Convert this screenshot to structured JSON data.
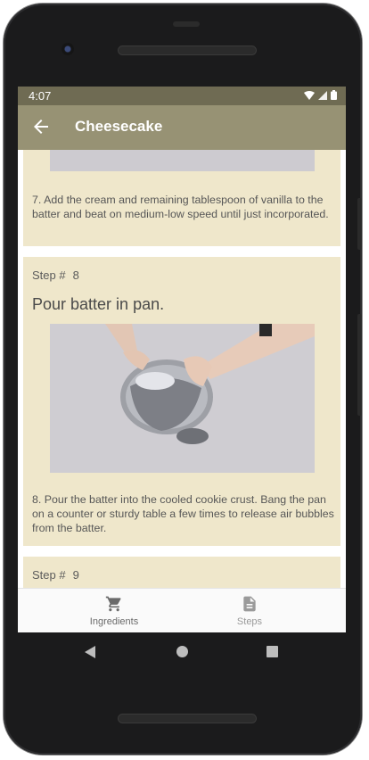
{
  "status_bar": {
    "time": "4:07"
  },
  "app_bar": {
    "title": "Cheesecake"
  },
  "steps": [
    {
      "description": "7. Add the cream and remaining tablespoon of vanilla to the batter and beat on medium-low speed until just incorporated."
    },
    {
      "step_prefix": "Step #",
      "number": "8",
      "short_description": "Pour batter in pan.",
      "description": "8. Pour the batter into the cooled cookie crust. Bang the pan on a counter or sturdy table a few times to release air bubbles from the batter."
    },
    {
      "step_prefix": "Step #",
      "number": "9"
    }
  ],
  "bottom_nav": {
    "items": [
      {
        "label": "Ingredients",
        "icon": "cart-icon"
      },
      {
        "label": "Steps",
        "icon": "document-icon"
      }
    ]
  },
  "colors": {
    "status_bar": "#6f6b53",
    "app_bar": "#979274",
    "card": "#efe7cb"
  }
}
